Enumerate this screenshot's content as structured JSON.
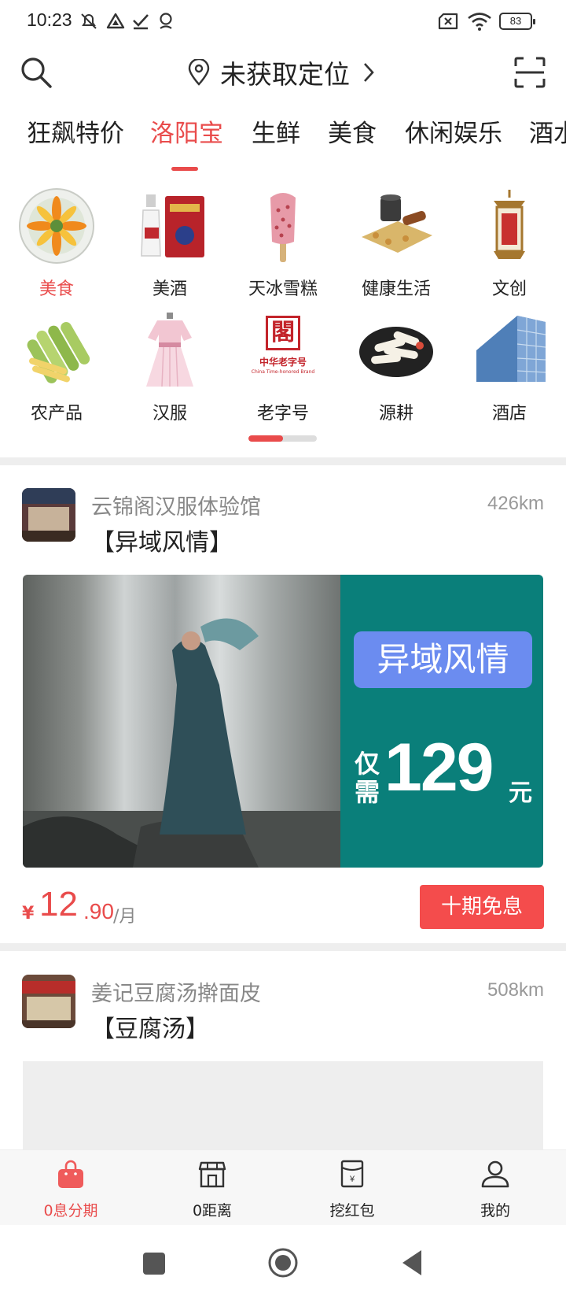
{
  "status_bar": {
    "time": "10:23",
    "battery": "83"
  },
  "header": {
    "location_text": "未获取定位"
  },
  "tabs": [
    {
      "label": "狂飙特价",
      "active": false
    },
    {
      "label": "洛阳宝",
      "active": true
    },
    {
      "label": "生鲜",
      "active": false
    },
    {
      "label": "美食",
      "active": false
    },
    {
      "label": "休闲娱乐",
      "active": false
    },
    {
      "label": "酒水",
      "active": false
    }
  ],
  "categories": [
    {
      "label": "美食",
      "icon": "food-plate-icon",
      "active": true
    },
    {
      "label": "美酒",
      "icon": "liquor-bottle-icon",
      "active": false
    },
    {
      "label": "天冰雪糕",
      "icon": "popsicle-icon",
      "active": false
    },
    {
      "label": "健康生活",
      "icon": "herbal-medicine-icon",
      "active": false
    },
    {
      "label": "文创",
      "icon": "lantern-icon",
      "active": false
    },
    {
      "label": "农产品",
      "icon": "vegetables-icon",
      "active": false
    },
    {
      "label": "汉服",
      "icon": "hanfu-dress-icon",
      "active": false
    },
    {
      "label": "老字号",
      "icon": "time-honored-brand-icon",
      "active": false
    },
    {
      "label": "源耕",
      "icon": "yam-slices-icon",
      "active": false
    },
    {
      "label": "酒店",
      "icon": "hotel-building-icon",
      "active": false
    }
  ],
  "brand_badge": {
    "glyph": "閣",
    "title": "中华老字号",
    "subtitle": "China Time-honored Brand"
  },
  "pager_progress": 0.5,
  "stores": [
    {
      "name": "云锦阁汉服体验馆",
      "distance": "426km",
      "title": "【异域风情】",
      "banner": {
        "tag": "异域风情",
        "only": "仅需",
        "price": "129",
        "unit": "元"
      },
      "price": {
        "symbol": "¥",
        "integer": "12",
        "decimal": ".90",
        "per": "/月"
      },
      "cta": "十期免息"
    },
    {
      "name": "姜记豆腐汤擀面皮",
      "distance": "508km",
      "title": "【豆腐汤】"
    }
  ],
  "bottom_nav": [
    {
      "label": "0息分期",
      "icon": "shopping-bag-icon",
      "active": true
    },
    {
      "label": "0距离",
      "icon": "storefront-icon",
      "active": false
    },
    {
      "label": "挖红包",
      "icon": "red-envelope-icon",
      "active": false
    },
    {
      "label": "我的",
      "icon": "user-profile-icon",
      "active": false
    }
  ],
  "colors": {
    "accent": "#e94b4b",
    "banner_panel": "#0a7f7a",
    "banner_tag": "#6b8cf0"
  }
}
